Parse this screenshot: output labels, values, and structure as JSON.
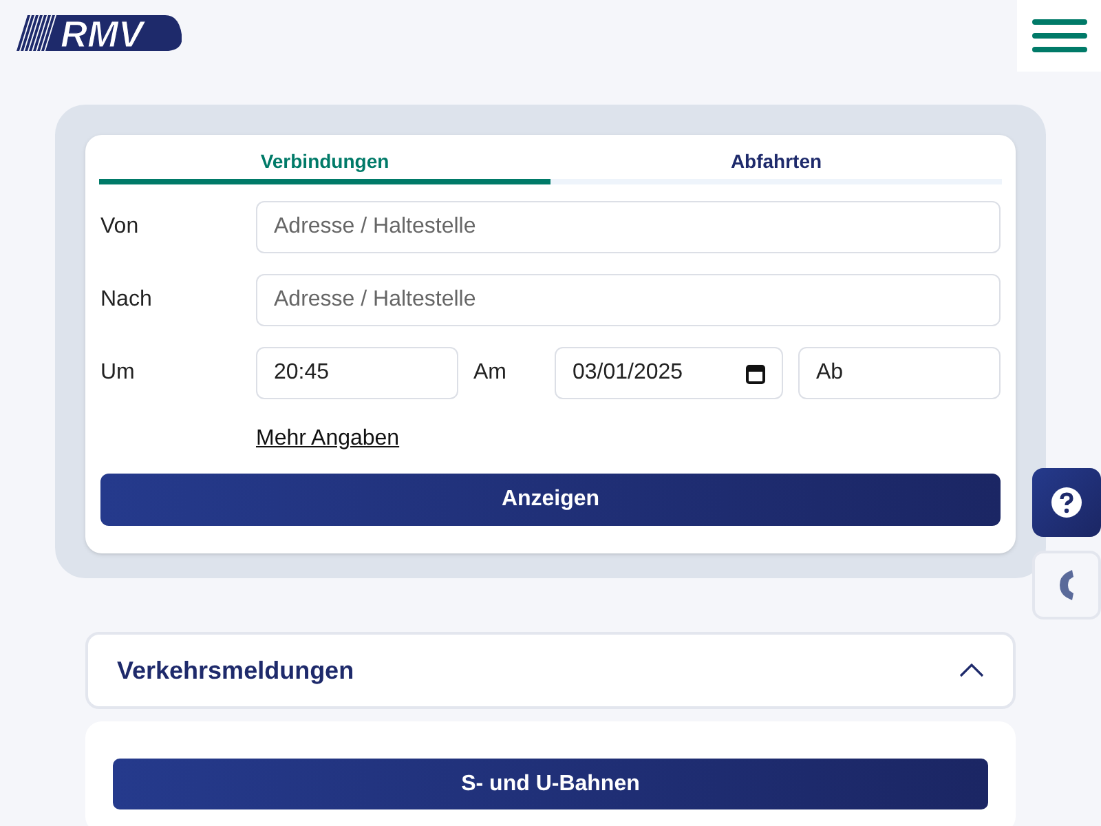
{
  "logo": {
    "text": "RMV"
  },
  "tabs": [
    {
      "label": "Verbindungen",
      "selected": true
    },
    {
      "label": "Abfahrten",
      "selected": false
    }
  ],
  "form": {
    "rows": [
      {
        "kind": "single",
        "label": "Von",
        "placeholder": "Adresse / Haltestelle"
      },
      {
        "kind": "single",
        "label": "Nach",
        "placeholder": "Adresse / Haltestelle"
      },
      {
        "kind": "time",
        "label": "Um",
        "time": "20:45",
        "date_label": "Am",
        "date": "03/01/2025",
        "mode": "Ab"
      }
    ],
    "more_link": "Mehr Angaben",
    "submit": "Anzeigen"
  },
  "traffic": {
    "title": "Verkehrsmeldungen",
    "expanded": true,
    "buttons": [
      {
        "kind": "full",
        "label": "S- und U-Bahnen"
      },
      {
        "kind": "cut"
      }
    ]
  }
}
